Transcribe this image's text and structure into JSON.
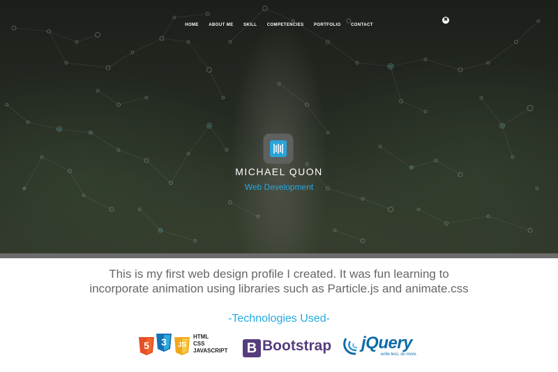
{
  "nav": {
    "items": [
      "HOME",
      "ABOUT ME",
      "SKILL",
      "COMPETENCIES",
      "PORTFOLIO",
      "CONTACT"
    ],
    "close_icon": "✖"
  },
  "hero": {
    "name": "MICHAEL QUON",
    "subtitle": "Web Development",
    "logo_icon": "logo-icon"
  },
  "main": {
    "description": "This is my first web design profile I created. It was fun learning to incorporate animation using libraries such as Particle.js and animate.css",
    "tech_title": "-Technologies Used-",
    "html5_num": "5",
    "css3_num": "3",
    "js_num": "JS",
    "stack_text": [
      "HTML",
      "CSS",
      "JAVASCRIPT"
    ],
    "bootstrap_letter": "B",
    "bootstrap_text": "Bootstrap",
    "jquery_text": "jQuery",
    "jquery_tagline": "write less, do more."
  },
  "colors": {
    "accent": "#24a9e1",
    "html5": "#e34f26",
    "css3": "#1572b6",
    "js": "#f0a81c",
    "bootstrap": "#563d7c",
    "jquery": "#0d6aa8"
  }
}
